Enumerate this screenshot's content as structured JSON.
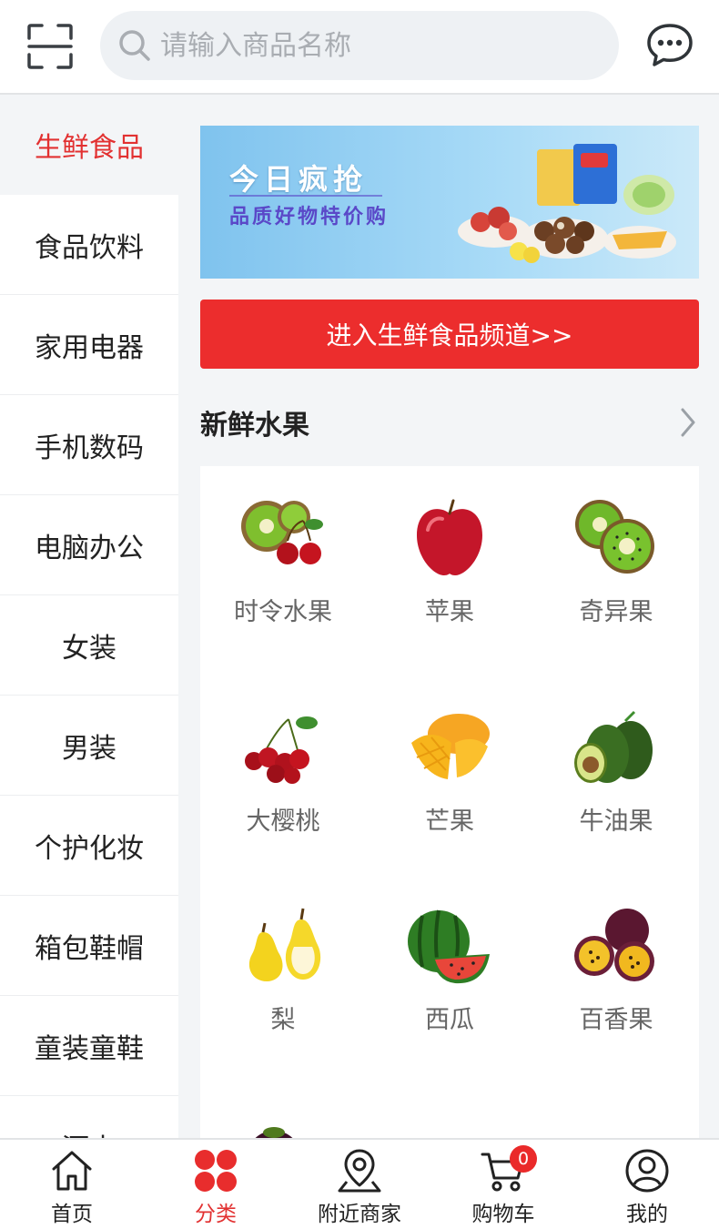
{
  "header": {
    "search_placeholder": "请输入商品名称"
  },
  "sidebar": {
    "items": [
      {
        "label": "生鲜食品",
        "active": true
      },
      {
        "label": "食品饮料"
      },
      {
        "label": "家用电器"
      },
      {
        "label": "手机数码"
      },
      {
        "label": "电脑办公"
      },
      {
        "label": "女装"
      },
      {
        "label": "男装"
      },
      {
        "label": "个护化妆"
      },
      {
        "label": "箱包鞋帽"
      },
      {
        "label": "童装童鞋"
      },
      {
        "label": "酒水"
      }
    ]
  },
  "main": {
    "banner": {
      "title": "今日疯抢",
      "subtitle": "品质好物特价购"
    },
    "channel_button": "进入生鲜食品频道>>",
    "section_title": "新鲜水果",
    "products": [
      {
        "label": "时令水果",
        "icon": "kiwi-cherry-icon"
      },
      {
        "label": "苹果",
        "icon": "apple-icon"
      },
      {
        "label": "奇异果",
        "icon": "kiwi-icon"
      },
      {
        "label": "大樱桃",
        "icon": "cherry-icon"
      },
      {
        "label": "芒果",
        "icon": "mango-icon"
      },
      {
        "label": "牛油果",
        "icon": "avocado-icon"
      },
      {
        "label": "梨",
        "icon": "pear-icon"
      },
      {
        "label": "西瓜",
        "icon": "watermelon-icon"
      },
      {
        "label": "百香果",
        "icon": "passionfruit-icon"
      }
    ]
  },
  "bottom_nav": {
    "items": [
      {
        "label": "首页",
        "icon": "home-icon"
      },
      {
        "label": "分类",
        "icon": "category-icon",
        "active": true
      },
      {
        "label": "附近商家",
        "icon": "location-icon"
      },
      {
        "label": "购物车",
        "icon": "cart-icon",
        "badge": "0"
      },
      {
        "label": "我的",
        "icon": "user-icon"
      }
    ]
  },
  "colors": {
    "accent": "#e23131",
    "button": "#ec2d2d",
    "background": "#f3f5f7"
  }
}
